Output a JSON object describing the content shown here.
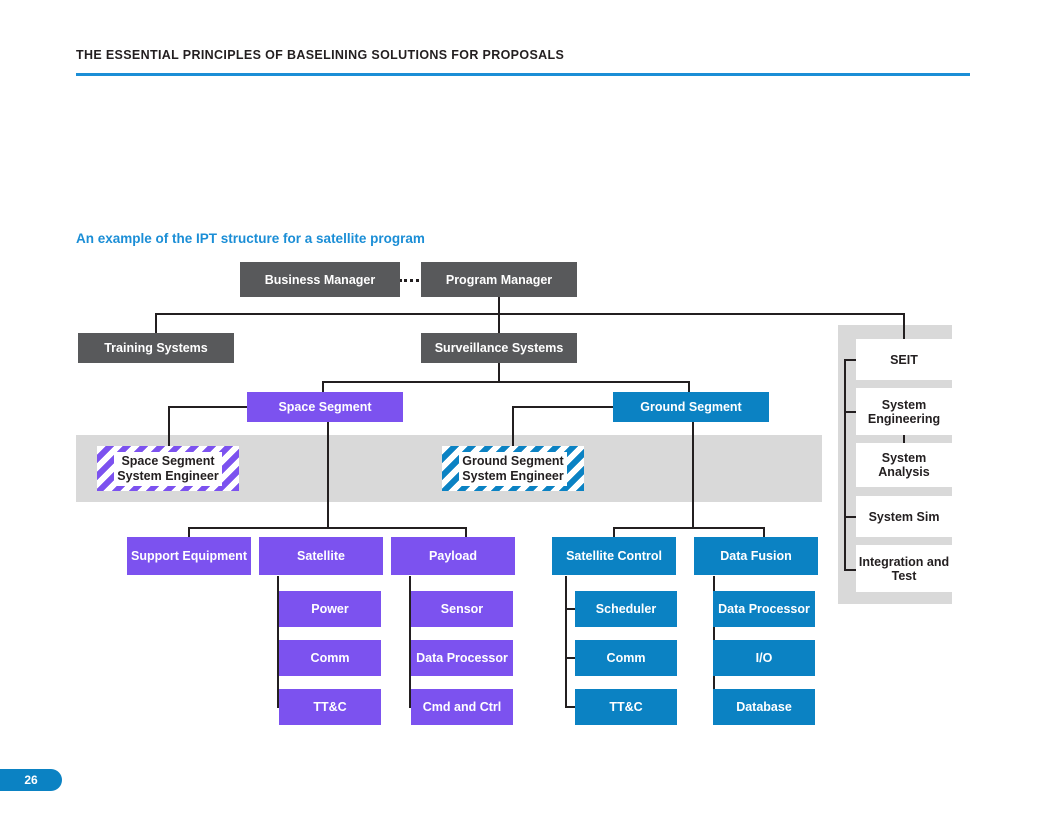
{
  "header": {
    "title": "THE ESSENTIAL PRINCIPLES OF BASELINING SOLUTIONS FOR PROPOSALS",
    "rule_color": "#1b8ed6"
  },
  "subtitle": "An example of the IPT structure for a satellite program",
  "colors": {
    "gray_node": "#58595b",
    "purple_node": "#7c52ef",
    "blue_node": "#0b82c3",
    "band_gray": "#d9d9d9",
    "white_node": "#ffffff",
    "line": "#231f20",
    "accent_blue": "#1b8ed6"
  },
  "chart_data": {
    "type": "diagram",
    "title": "An example of the IPT structure for a satellite program",
    "nodes": [
      {
        "id": "business-manager",
        "label": "Business Manager",
        "level": 0,
        "color": "#58595b"
      },
      {
        "id": "program-manager",
        "label": "Program Manager",
        "level": 0,
        "color": "#58595b"
      },
      {
        "id": "training-systems",
        "label": "Training Systems",
        "level": 1,
        "color": "#58595b"
      },
      {
        "id": "surveillance-systems",
        "label": "Surveillance Systems",
        "level": 1,
        "color": "#58595b"
      },
      {
        "id": "space-segment",
        "label": "Space Segment",
        "level": 2,
        "color": "#7c52ef"
      },
      {
        "id": "ground-segment",
        "label": "Ground Segment",
        "level": 2,
        "color": "#0b82c3"
      },
      {
        "id": "space-segment-se",
        "label": "Space Segment System Engineer",
        "level": 3,
        "color": "#7c52ef",
        "style": "hatched"
      },
      {
        "id": "ground-segment-se",
        "label": "Ground Segment System Engineer",
        "level": 3,
        "color": "#0b82c3",
        "style": "hatched"
      },
      {
        "id": "support-equipment",
        "label": "Support Equipment",
        "level": 4,
        "color": "#7c52ef"
      },
      {
        "id": "satellite",
        "label": "Satellite",
        "level": 4,
        "color": "#7c52ef"
      },
      {
        "id": "payload",
        "label": "Payload",
        "level": 4,
        "color": "#7c52ef"
      },
      {
        "id": "satellite-control",
        "label": "Satellite Control",
        "level": 4,
        "color": "#0b82c3"
      },
      {
        "id": "data-fusion",
        "label": "Data Fusion",
        "level": 4,
        "color": "#0b82c3"
      },
      {
        "id": "satellite-power",
        "label": "Power",
        "level": 5,
        "color": "#7c52ef"
      },
      {
        "id": "satellite-comm",
        "label": "Comm",
        "level": 5,
        "color": "#7c52ef"
      },
      {
        "id": "satellite-ttc",
        "label": "TT&C",
        "level": 5,
        "color": "#7c52ef"
      },
      {
        "id": "payload-sensor",
        "label": "Sensor",
        "level": 5,
        "color": "#7c52ef"
      },
      {
        "id": "payload-data-processor",
        "label": "Data Processor",
        "level": 5,
        "color": "#7c52ef"
      },
      {
        "id": "payload-cmd-and-ctrl",
        "label": "Cmd and Ctrl",
        "level": 5,
        "color": "#7c52ef"
      },
      {
        "id": "satctrl-scheduler",
        "label": "Scheduler",
        "level": 5,
        "color": "#0b82c3"
      },
      {
        "id": "satctrl-comm",
        "label": "Comm",
        "level": 5,
        "color": "#0b82c3"
      },
      {
        "id": "satctrl-ttc",
        "label": "TT&C",
        "level": 5,
        "color": "#0b82c3"
      },
      {
        "id": "fusion-data-processor",
        "label": "Data Processor",
        "level": 5,
        "color": "#0b82c3"
      },
      {
        "id": "fusion-io",
        "label": "I/O",
        "level": 5,
        "color": "#0b82c3"
      },
      {
        "id": "fusion-database",
        "label": "Database",
        "level": 5,
        "color": "#0b82c3"
      },
      {
        "id": "seit",
        "label": "SEIT",
        "level": 1,
        "color": "#ffffff"
      },
      {
        "id": "system-engineering",
        "label": "System Engineering",
        "level": 2,
        "color": "#ffffff"
      },
      {
        "id": "system-analysis",
        "label": "System Analysis",
        "level": 3,
        "color": "#ffffff"
      },
      {
        "id": "system-sim",
        "label": "System Sim",
        "level": 2,
        "color": "#ffffff"
      },
      {
        "id": "integration-and-test",
        "label": "Integration and Test",
        "level": 2,
        "color": "#ffffff"
      }
    ],
    "edges": [
      {
        "from": "business-manager",
        "to": "program-manager",
        "style": "dotted"
      },
      {
        "from": "program-manager",
        "to": "training-systems"
      },
      {
        "from": "program-manager",
        "to": "surveillance-systems"
      },
      {
        "from": "program-manager",
        "to": "seit"
      },
      {
        "from": "surveillance-systems",
        "to": "space-segment"
      },
      {
        "from": "surveillance-systems",
        "to": "ground-segment"
      },
      {
        "from": "space-segment",
        "to": "space-segment-se"
      },
      {
        "from": "ground-segment",
        "to": "ground-segment-se"
      },
      {
        "from": "space-segment",
        "to": "support-equipment"
      },
      {
        "from": "space-segment",
        "to": "satellite"
      },
      {
        "from": "space-segment",
        "to": "payload"
      },
      {
        "from": "ground-segment",
        "to": "satellite-control"
      },
      {
        "from": "ground-segment",
        "to": "data-fusion"
      },
      {
        "from": "satellite",
        "to": "satellite-power"
      },
      {
        "from": "satellite",
        "to": "satellite-comm"
      },
      {
        "from": "satellite",
        "to": "satellite-ttc"
      },
      {
        "from": "payload",
        "to": "payload-sensor"
      },
      {
        "from": "payload",
        "to": "payload-data-processor"
      },
      {
        "from": "payload",
        "to": "payload-cmd-and-ctrl"
      },
      {
        "from": "satellite-control",
        "to": "satctrl-scheduler"
      },
      {
        "from": "satellite-control",
        "to": "satctrl-comm"
      },
      {
        "from": "satellite-control",
        "to": "satctrl-ttc"
      },
      {
        "from": "data-fusion",
        "to": "fusion-data-processor"
      },
      {
        "from": "data-fusion",
        "to": "fusion-io"
      },
      {
        "from": "data-fusion",
        "to": "fusion-database"
      },
      {
        "from": "seit",
        "to": "system-engineering"
      },
      {
        "from": "system-engineering",
        "to": "system-analysis"
      },
      {
        "from": "seit",
        "to": "system-sim"
      },
      {
        "from": "seit",
        "to": "integration-and-test"
      }
    ]
  },
  "diagram": {
    "business_manager": "Business Manager",
    "program_manager": "Program Manager",
    "training_systems": "Training Systems",
    "surveillance_systems": "Surveillance Systems",
    "space_segment": "Space Segment",
    "ground_segment": "Ground Segment",
    "space_segment_se_line1": "Space Segment",
    "space_segment_se_line2": "System Engineer",
    "ground_segment_se_line1": "Ground Segment",
    "ground_segment_se_line2": "System Engineer",
    "support_equipment": "Support Equipment",
    "satellite": "Satellite",
    "payload": "Payload",
    "satellite_control": "Satellite Control",
    "data_fusion": "Data Fusion",
    "satellite_power": "Power",
    "satellite_comm": "Comm",
    "satellite_ttc": "TT&C",
    "payload_sensor": "Sensor",
    "payload_data_processor": "Data Processor",
    "payload_cmd_and_ctrl": "Cmd and Ctrl",
    "satctrl_scheduler": "Scheduler",
    "satctrl_comm": "Comm",
    "satctrl_ttc": "TT&C",
    "fusion_data_processor": "Data Processor",
    "fusion_io": "I/O",
    "fusion_database": "Database",
    "seit": "SEIT",
    "system_engineering": "System Engineering",
    "system_analysis": "System Analysis",
    "system_sim": "System Sim",
    "integration_and_test": "Integration and Test"
  },
  "footer": {
    "page_number": "26"
  }
}
